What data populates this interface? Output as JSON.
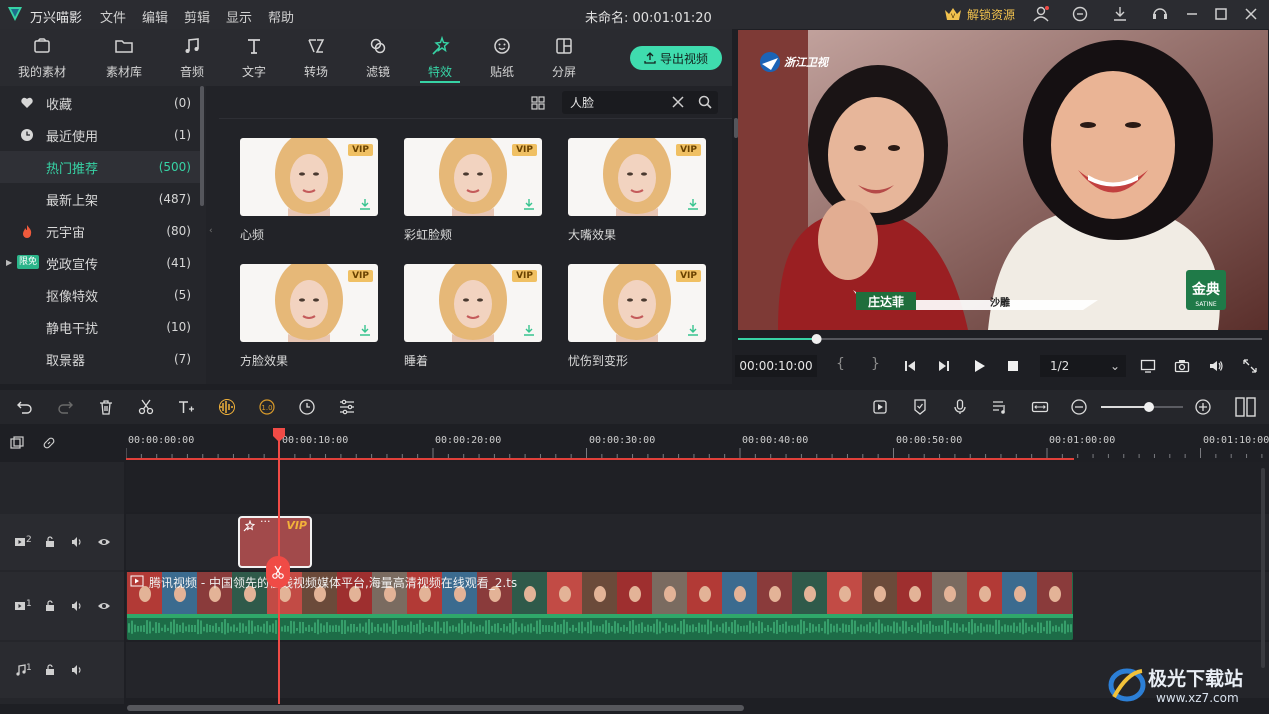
{
  "app": {
    "name": "万兴喵影",
    "menu": [
      "文件",
      "编辑",
      "剪辑",
      "显示",
      "帮助"
    ],
    "title": "未命名: 00:01:01:20",
    "unlock_label": "解锁资源"
  },
  "tabs": [
    {
      "label": "我的素材",
      "icon": "folder-media-icon"
    },
    {
      "label": "素材库",
      "icon": "folder-icon"
    },
    {
      "label": "音频",
      "icon": "music-note-icon"
    },
    {
      "label": "文字",
      "icon": "text-icon"
    },
    {
      "label": "转场",
      "icon": "transition-icon"
    },
    {
      "label": "滤镜",
      "icon": "filter-icon"
    },
    {
      "label": "特效",
      "icon": "sparkle-wand-icon",
      "active": true
    },
    {
      "label": "贴纸",
      "icon": "sticker-face-icon"
    },
    {
      "label": "分屏",
      "icon": "split-screen-icon"
    }
  ],
  "export_label": "导出视频",
  "categories": [
    {
      "label": "收藏",
      "count": "(0)",
      "icon": "heart-icon"
    },
    {
      "label": "最近使用",
      "count": "(1)",
      "icon": "clock-icon"
    },
    {
      "label": "热门推荐",
      "count": "(500)",
      "active": true
    },
    {
      "label": "最新上架",
      "count": "(487)"
    },
    {
      "label": "元宇宙",
      "count": "(80)",
      "icon": "flame-icon"
    },
    {
      "label": "党政宣传",
      "count": "(41)",
      "badge": "限免"
    },
    {
      "label": "抠像特效",
      "count": "(5)"
    },
    {
      "label": "静电干扰",
      "count": "(10)"
    },
    {
      "label": "取景器",
      "count": "(7)"
    }
  ],
  "search": {
    "value": "人脸"
  },
  "effects": [
    {
      "name": "心频",
      "badge": "VIP"
    },
    {
      "name": "彩虹脸颊",
      "badge": "VIP"
    },
    {
      "name": "大嘴效果",
      "badge": "VIP"
    },
    {
      "name": "方脸效果",
      "badge": "VIP"
    },
    {
      "name": "睡着",
      "badge": "VIP"
    },
    {
      "name": "忧伤到变形",
      "badge": "VIP"
    }
  ],
  "preview": {
    "channel_logo": "浙江卫视",
    "lower_third_name": "庄达菲",
    "lower_third_tag": "沙雕",
    "sponsor": "金典",
    "sponsor_sub": "SATINE",
    "time": "00:00:10:00",
    "ratio": "1/2",
    "progress": 0.15
  },
  "ruler": [
    "00:00:00:00",
    "00:00:10:00",
    "00:00:20:00",
    "00:00:30:00",
    "00:00:40:00",
    "00:00:50:00",
    "00:01:00:00",
    "00:01:10:00"
  ],
  "tracks": {
    "fx_label": "2",
    "video_label": "1",
    "audio_label": "1"
  },
  "fx_clip": {
    "badge": "VIP",
    "more": "···"
  },
  "video_clip": {
    "title": "腾讯视频 - 中国领先的在线视频媒体平台,海量高清视频在线观看_2.ts"
  },
  "watermark": {
    "name": "极光下载站",
    "url": "www.xz7.com"
  },
  "colors": {
    "accent": "#37d3a5",
    "playhead": "#f04b46",
    "clip_video": "#1d6c47",
    "clip_fx": "#a24a4b"
  }
}
